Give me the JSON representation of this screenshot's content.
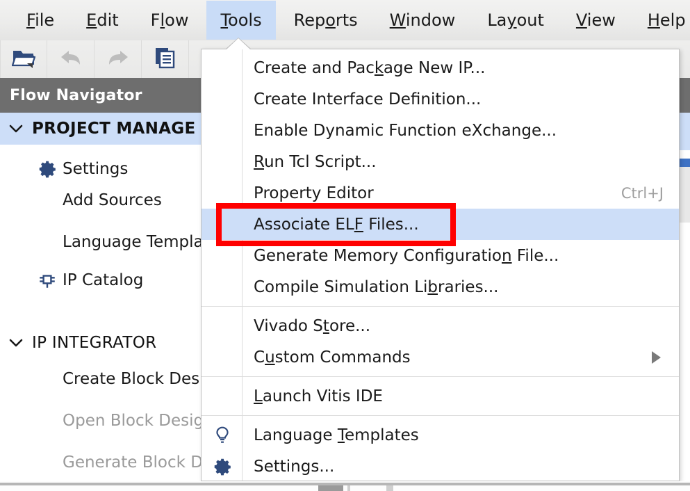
{
  "menubar": {
    "items": [
      {
        "label": "File",
        "mnemonic_index": 0,
        "active": false
      },
      {
        "label": "Edit",
        "mnemonic_index": 0,
        "active": false
      },
      {
        "label": "Flow",
        "mnemonic_index": 1,
        "active": false
      },
      {
        "label": "Tools",
        "mnemonic_index": 0,
        "active": true
      },
      {
        "label": "Reports",
        "mnemonic_index": 3,
        "active": false
      },
      {
        "label": "Window",
        "mnemonic_index": 0,
        "active": false
      },
      {
        "label": "Layout",
        "mnemonic_index": 2,
        "active": false
      },
      {
        "label": "View",
        "mnemonic_index": 0,
        "active": false
      },
      {
        "label": "Help",
        "mnemonic_index": 0,
        "active": false
      }
    ]
  },
  "toolbar": {
    "buttons": [
      {
        "icon": "open-project-icon",
        "enabled": true
      },
      {
        "icon": "undo-arrow-icon",
        "enabled": false
      },
      {
        "icon": "redo-arrow-icon",
        "enabled": false
      },
      {
        "icon": "document-icon",
        "enabled": true
      }
    ]
  },
  "flow_navigator": {
    "title": "Flow Navigator",
    "sections": [
      {
        "label": "PROJECT MANAGE",
        "selected": true,
        "expanded": true,
        "items": [
          {
            "label": "Settings",
            "icon": "gear-icon",
            "disabled": false
          },
          {
            "label": "Add Sources",
            "icon": null,
            "disabled": false
          },
          {
            "label": "Language Templa",
            "icon": null,
            "disabled": false
          },
          {
            "label": "IP Catalog",
            "icon": "ip-chip-icon",
            "disabled": false
          }
        ]
      },
      {
        "label": "IP INTEGRATOR",
        "selected": false,
        "expanded": true,
        "items": [
          {
            "label": "Create Block Des",
            "icon": null,
            "disabled": false
          },
          {
            "label": "Open Block Desig",
            "icon": null,
            "disabled": true
          },
          {
            "label": "Generate Block D",
            "icon": null,
            "disabled": true
          }
        ]
      }
    ]
  },
  "tools_menu": {
    "groups": [
      {
        "items": [
          {
            "label": "Create and Package New IP...",
            "mnemonic_index": 14,
            "icon": null,
            "accel": null,
            "submenu": false,
            "highlighted": false,
            "annotated": false
          },
          {
            "label": "Create Interface Definition...",
            "mnemonic_index": -1,
            "icon": null,
            "accel": null,
            "submenu": false,
            "highlighted": false,
            "annotated": false
          },
          {
            "label": "Enable Dynamic Function eXchange...",
            "mnemonic_index": -1,
            "icon": null,
            "accel": null,
            "submenu": false,
            "highlighted": false,
            "annotated": false
          },
          {
            "label": "Run Tcl Script...",
            "mnemonic_index": 0,
            "icon": null,
            "accel": null,
            "submenu": false,
            "highlighted": false,
            "annotated": false
          },
          {
            "label": "Property Editor",
            "mnemonic_index": -1,
            "icon": null,
            "accel": "Ctrl+J",
            "submenu": false,
            "highlighted": false,
            "annotated": false
          },
          {
            "label": "Associate ELF Files...",
            "mnemonic_index": 12,
            "icon": null,
            "accel": null,
            "submenu": false,
            "highlighted": true,
            "annotated": true
          },
          {
            "label": "Generate Memory Configuration File...",
            "mnemonic_index": 28,
            "icon": null,
            "accel": null,
            "submenu": false,
            "highlighted": false,
            "annotated": false
          },
          {
            "label": "Compile Simulation Libraries...",
            "mnemonic_index": 21,
            "icon": null,
            "accel": null,
            "submenu": false,
            "highlighted": false,
            "annotated": false
          }
        ]
      },
      {
        "items": [
          {
            "label": "Vivado Store...",
            "mnemonic_index": 8,
            "icon": null,
            "accel": null,
            "submenu": false,
            "highlighted": false,
            "annotated": false
          },
          {
            "label": "Custom Commands",
            "mnemonic_index": 1,
            "icon": null,
            "accel": null,
            "submenu": true,
            "highlighted": false,
            "annotated": false
          }
        ]
      },
      {
        "items": [
          {
            "label": "Launch Vitis IDE",
            "mnemonic_index": 0,
            "icon": null,
            "accel": null,
            "submenu": false,
            "highlighted": false,
            "annotated": false
          }
        ]
      },
      {
        "items": [
          {
            "label": "Language Templates",
            "mnemonic_index": 9,
            "icon": "lightbulb-icon",
            "accel": null,
            "submenu": false,
            "highlighted": false,
            "annotated": false
          },
          {
            "label": "Settings...",
            "mnemonic_index": -1,
            "icon": "gear-icon",
            "accel": null,
            "submenu": false,
            "highlighted": false,
            "annotated": false
          }
        ]
      }
    ]
  },
  "annotation": {
    "shape": "rectangle",
    "color": "#ff0000",
    "target": "Associate ELF Files..."
  },
  "colors": {
    "menubar_active_bg": "#c9dcf7",
    "menu_highlight_bg": "#cddef8",
    "panel_header_bg": "#6e6e6e",
    "icon_blue": "#2f4a7c",
    "accent_blue": "#3f72c4",
    "annotation_red": "#ff0000",
    "accel_text": "#9d9d9d",
    "disabled_text": "#9a9a9a"
  }
}
